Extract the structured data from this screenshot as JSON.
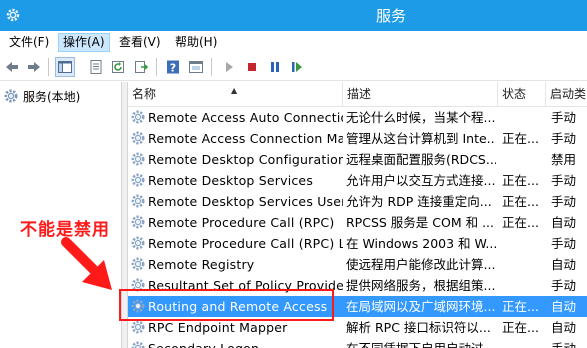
{
  "window": {
    "title": "服务"
  },
  "menu": {
    "items": [
      "文件(F)",
      "操作(A)",
      "查看(V)",
      "帮助(H)"
    ],
    "active_index": 1
  },
  "toolbar": {
    "icons": [
      "back-icon",
      "forward-icon",
      "show-hide-tree-icon",
      "properties-icon",
      "refresh-icon",
      "export-list-icon",
      "help-icon",
      "console-icon",
      "start-service-icon",
      "stop-service-icon",
      "pause-service-icon",
      "resume-service-icon"
    ]
  },
  "tree": {
    "root_label": "服务(本地)"
  },
  "columns": {
    "name": "名称",
    "description": "描述",
    "status": "状态",
    "startup": "启动类"
  },
  "services": [
    {
      "name": "Remote Access Auto Connectio...",
      "description": "无论什么时候，当某个程...",
      "status": "",
      "startup": "手动"
    },
    {
      "name": "Remote Access Connection Ma...",
      "description": "管理从这台计算机到 Inte...",
      "status": "正在...",
      "startup": "手动"
    },
    {
      "name": "Remote Desktop Configuration",
      "description": "远程桌面配置服务(RDCS...",
      "status": "",
      "startup": "禁用"
    },
    {
      "name": "Remote Desktop Services",
      "description": "允许用户以交互方式连接...",
      "status": "正在...",
      "startup": "手动"
    },
    {
      "name": "Remote Desktop Services User...",
      "description": "允许为 RDP 连接重定向...",
      "status": "正在...",
      "startup": "手动"
    },
    {
      "name": "Remote Procedure Call (RPC)",
      "description": "RPCSS 服务是 COM 和 ...",
      "status": "正在...",
      "startup": "自动"
    },
    {
      "name": "Remote Procedure Call (RPC) L...",
      "description": "在 Windows 2003 和 W...",
      "status": "",
      "startup": "手动"
    },
    {
      "name": "Remote Registry",
      "description": "使远程用户能修改此计算...",
      "status": "",
      "startup": "自动"
    },
    {
      "name": "Resultant Set of Policy Provider",
      "description": "提供网络服务，根据组策...",
      "status": "",
      "startup": "手动"
    },
    {
      "name": "Routing and Remote Access",
      "description": "在局域网以及广域网环境...",
      "status": "正在...",
      "startup": "自动"
    },
    {
      "name": "RPC Endpoint Mapper",
      "description": "解析 RPC 接口标识符以...",
      "status": "正在...",
      "startup": "自动"
    },
    {
      "name": "Secondary Logon",
      "description": "在不同凭据下启用启动过...",
      "status": "",
      "startup": "手动"
    }
  ],
  "selected_service_index": 9,
  "annotation": {
    "label": "不能是禁用"
  },
  "colors": {
    "titlebar": "#1e9be6",
    "selection": "#3399ff",
    "annotation": "#ff1a1a",
    "gear": "#7a97b8"
  }
}
